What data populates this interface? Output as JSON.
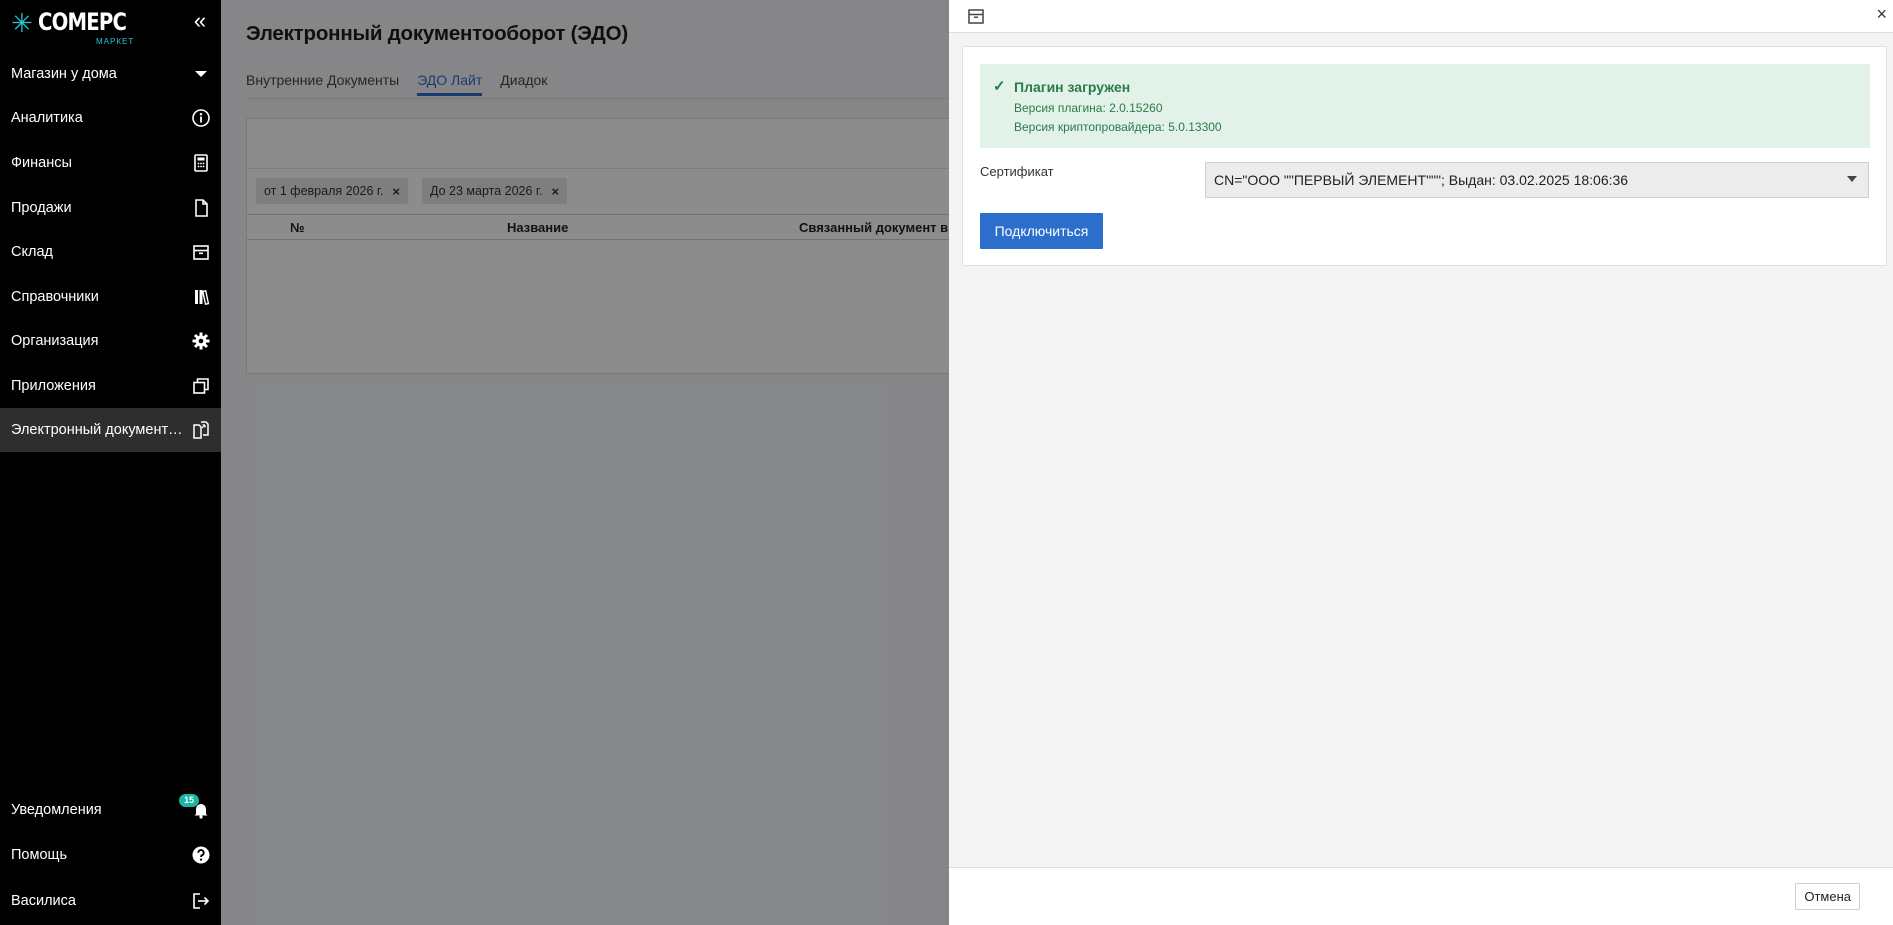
{
  "app": {
    "logo_text": "COMEPC",
    "logo_subtitle": "МАРКЕТ",
    "collapse_icon": "double-chevron-left-icon"
  },
  "sidebar": {
    "store_selector": {
      "label": "Магазин у дома",
      "icon": "caret-down-icon"
    },
    "items": [
      {
        "label": "Аналитика",
        "icon": "info-circle-icon"
      },
      {
        "label": "Финансы",
        "icon": "calculator-icon"
      },
      {
        "label": "Продажи",
        "icon": "document-icon"
      },
      {
        "label": "Склад",
        "icon": "box-icon"
      },
      {
        "label": "Справочники",
        "icon": "books-icon"
      },
      {
        "label": "Организация",
        "icon": "gear-icon"
      },
      {
        "label": "Приложения",
        "icon": "windows-icon"
      },
      {
        "label": "Электронный документо...",
        "icon": "documents-exchange-icon",
        "active": true
      }
    ],
    "bottom": [
      {
        "label": "Уведомления",
        "icon": "bell-icon",
        "badge": "15"
      },
      {
        "label": "Помощь",
        "icon": "question-circle-icon"
      },
      {
        "label": "Василиса",
        "icon": "logout-icon"
      }
    ]
  },
  "main": {
    "title": "Электронный документооборот (ЭДО)",
    "tabs": [
      {
        "label": "Внутренние Документы",
        "active": false
      },
      {
        "label": "ЭДО Лайт",
        "active": true
      },
      {
        "label": "Диадок",
        "active": false
      }
    ],
    "filters": [
      {
        "label": "от 1 февраля 2026 г.",
        "remove": "×"
      },
      {
        "label": "До 23 марта 2026 г.",
        "remove": "×"
      }
    ],
    "table_headers": [
      "№",
      "Название",
      "Связанный документ в С"
    ]
  },
  "drawer": {
    "header_icon": "box-icon",
    "close_label": "×",
    "alert": {
      "title": "Плагин загружен",
      "plugin_version": "Версия плагина: 2.0.15260",
      "crypto_version": "Версия криптопровайдера: 5.0.13300",
      "color": "#2b7a4b"
    },
    "certificate": {
      "label": "Сертификат",
      "value": "CN=\"ООО \"\"ПЕРВЫЙ ЭЛЕМЕНТ\"\"\"; Выдан: 03.02.2025 18:06:36"
    },
    "connect_label": "Подключиться",
    "cancel_label": "Отмена"
  },
  "colors": {
    "accent": "#2c6ecb",
    "sidebar_bg": "#000000",
    "success_bg": "#e3f2e8",
    "badge": "#19b5a5",
    "logo_accent": "#2bc6d4"
  }
}
